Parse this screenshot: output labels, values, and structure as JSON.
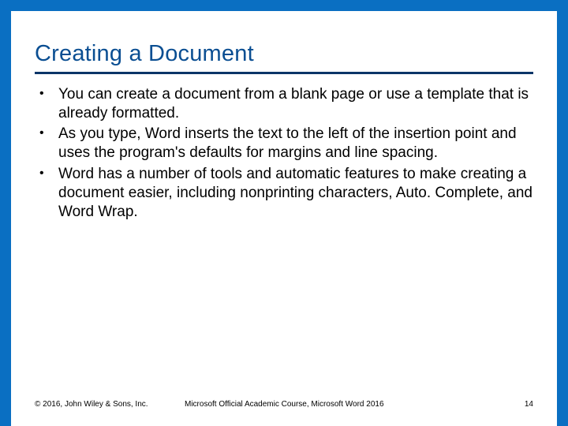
{
  "slide": {
    "title": "Creating a Document",
    "bullets": [
      "You can create a document from a blank page or use a template that is already formatted.",
      "As you type, Word inserts the text to the left of the insertion point and uses the program's defaults for margins and line spacing.",
      "Word has a number of tools and automatic features to make creating a document easier, including nonprinting characters, Auto. Complete, and Word Wrap."
    ]
  },
  "footer": {
    "copyright": "© 2016, John Wiley & Sons, Inc.",
    "course": "Microsoft Official Academic Course, Microsoft Word 2016",
    "page": "14"
  }
}
